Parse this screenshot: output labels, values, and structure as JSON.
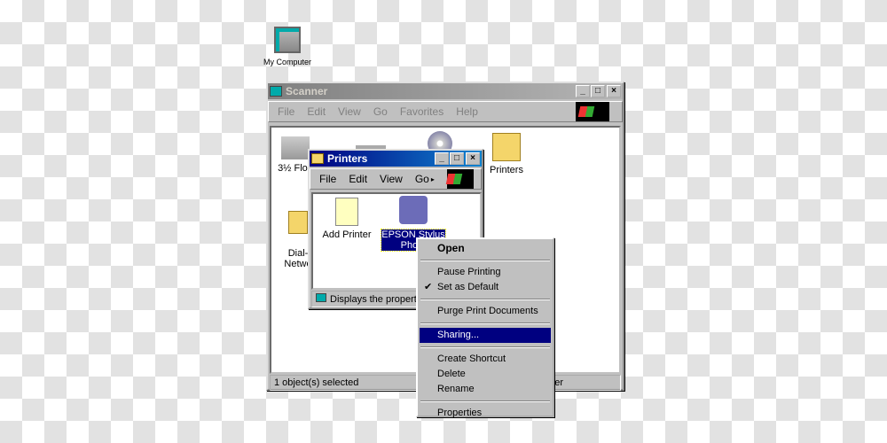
{
  "desktop": {
    "icon_label": "My Computer"
  },
  "scanner": {
    "title": "Scanner",
    "menu": [
      "File",
      "Edit",
      "View",
      "Go",
      "Favorites",
      "Help"
    ],
    "icons": [
      "3½ Flop",
      "Printers",
      "Dial-\nNetwo"
    ],
    "status": "1 object(s) selected",
    "status_right": "er"
  },
  "printers": {
    "title": "Printers",
    "menu": [
      "File",
      "Edit",
      "View",
      "Go"
    ],
    "icons": [
      "Add Printer",
      "EPSON Stylus Photo"
    ],
    "status": "Displays the properti"
  },
  "context_menu": {
    "items": [
      "Open",
      "Pause Printing",
      "Set as Default",
      "Purge Print Documents",
      "Sharing...",
      "Create Shortcut",
      "Delete",
      "Rename",
      "Properties"
    ],
    "checked": "Set as Default",
    "highlighted": "Sharing..."
  },
  "colors": {
    "active_title": "#000080",
    "selection": "#000080"
  }
}
